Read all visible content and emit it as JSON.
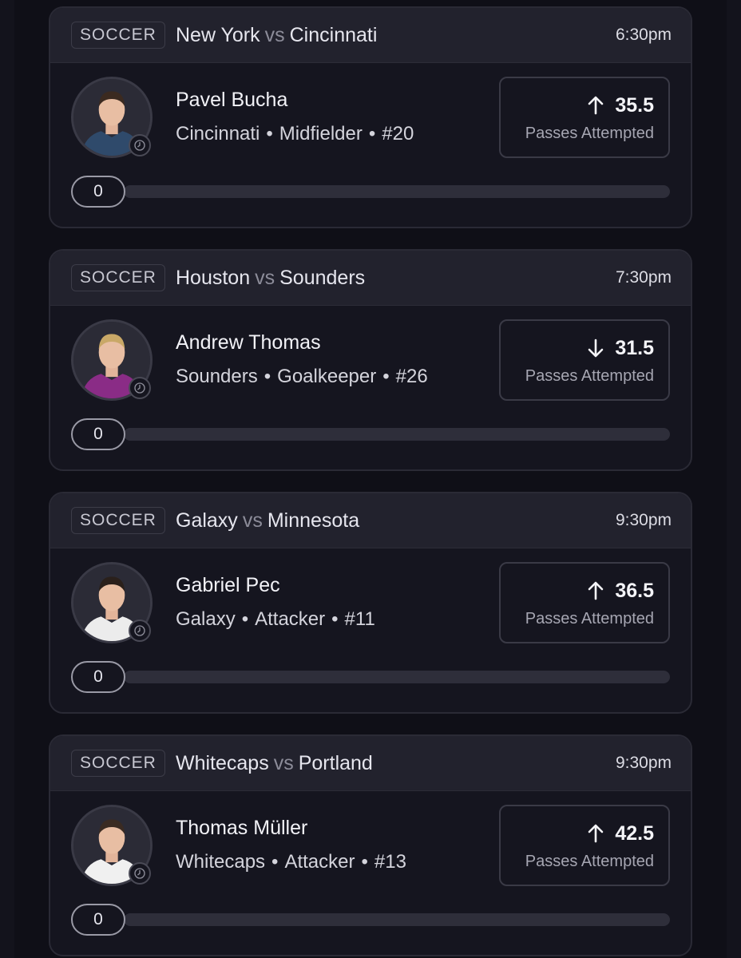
{
  "cards": [
    {
      "sport": "SOCCER",
      "home": "New York",
      "vs": "vs",
      "away": "Cincinnati",
      "time": "6:30pm",
      "player": {
        "name": "Pavel Bucha",
        "team": "Cincinnati",
        "position": "Midfielder",
        "number": "#20",
        "jersey_color": "#2f4a6b",
        "hair_color": "#3b2a20"
      },
      "line": {
        "direction": "up",
        "direction_icon": "arrow-up-icon",
        "value": "35.5",
        "stat": "Passes Attempted"
      },
      "progress": {
        "value": "0",
        "fraction": 0
      }
    },
    {
      "sport": "SOCCER",
      "home": "Houston",
      "vs": "vs",
      "away": "Sounders",
      "time": "7:30pm",
      "player": {
        "name": "Andrew Thomas",
        "team": "Sounders",
        "position": "Goalkeeper",
        "number": "#26",
        "jersey_color": "#8a2c86",
        "hair_color": "#c9a867"
      },
      "line": {
        "direction": "down",
        "direction_icon": "arrow-down-icon",
        "value": "31.5",
        "stat": "Passes Attempted"
      },
      "progress": {
        "value": "0",
        "fraction": 0
      }
    },
    {
      "sport": "SOCCER",
      "home": "Galaxy",
      "vs": "vs",
      "away": "Minnesota",
      "time": "9:30pm",
      "player": {
        "name": "Gabriel Pec",
        "team": "Galaxy",
        "position": "Attacker",
        "number": "#11",
        "jersey_color": "#ececec",
        "hair_color": "#2a201b"
      },
      "line": {
        "direction": "up",
        "direction_icon": "arrow-up-icon",
        "value": "36.5",
        "stat": "Passes Attempted"
      },
      "progress": {
        "value": "0",
        "fraction": 0
      }
    },
    {
      "sport": "SOCCER",
      "home": "Whitecaps",
      "vs": "vs",
      "away": "Portland",
      "time": "9:30pm",
      "player": {
        "name": "Thomas Müller",
        "team": "Whitecaps",
        "position": "Attacker",
        "number": "#13",
        "jersey_color": "#f0f0f0",
        "hair_color": "#3a2b22"
      },
      "line": {
        "direction": "up",
        "direction_icon": "arrow-up-icon",
        "value": "42.5",
        "stat": "Passes Attempted"
      },
      "progress": {
        "value": "0",
        "fraction": 0
      }
    }
  ],
  "colors": {
    "background": "#0f0f17",
    "card": "#15151f",
    "header": "#22222d",
    "text_primary": "#f2f2f7",
    "text_secondary": "#a6a6b2"
  }
}
